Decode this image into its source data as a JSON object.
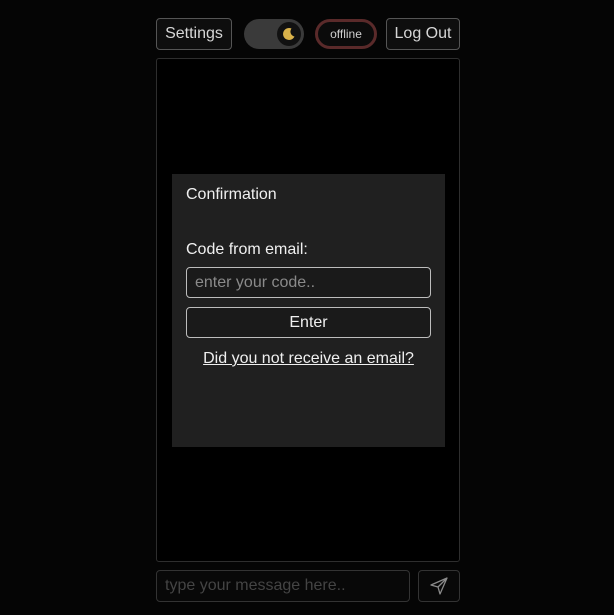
{
  "header": {
    "settings_label": "Settings",
    "theme_toggle_icon": "moon-icon",
    "status_label": "offline",
    "logout_label": "Log Out"
  },
  "modal": {
    "title": "Confirmation",
    "code_label": "Code from email:",
    "code_placeholder": "enter your code..",
    "enter_label": "Enter",
    "resend_link": "Did you not receive an email?"
  },
  "composer": {
    "message_placeholder": "type your message here..",
    "send_icon": "send-icon"
  },
  "colors": {
    "background": "#050505",
    "modal_background": "#202020",
    "status_ring": "#5a2a2a"
  }
}
